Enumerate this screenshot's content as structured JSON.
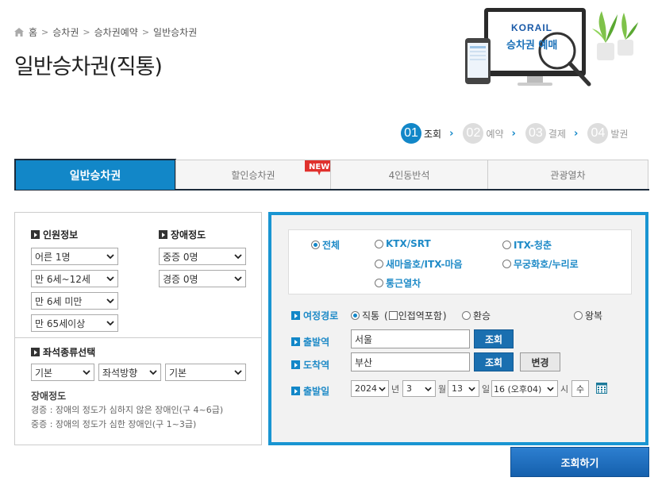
{
  "breadcrumb": [
    "홈",
    "승차권",
    "승차권예약",
    "일반승차권"
  ],
  "page_title": "일반승차권(직통)",
  "hero": {
    "brand": "KORAIL",
    "caption": "승차권 예매"
  },
  "steps": [
    {
      "num": "01",
      "label": "조회",
      "active": true
    },
    {
      "num": "02",
      "label": "예약",
      "active": false
    },
    {
      "num": "03",
      "label": "결제",
      "active": false
    },
    {
      "num": "04",
      "label": "발권",
      "active": false
    }
  ],
  "tabs": [
    {
      "label": "일반승차권",
      "active": true
    },
    {
      "label": "할인승차권",
      "badge": "NEW"
    },
    {
      "label": "4인동반석"
    },
    {
      "label": "관광열차"
    }
  ],
  "passengers": {
    "title": "인원정보",
    "adult": "어른 1명",
    "child": "만 6세~12세",
    "infant": "만 6세 미만",
    "senior": "만 65세이상"
  },
  "disability": {
    "title": "장애정도",
    "severe": "중증 0명",
    "mild": "경증 0명"
  },
  "seat": {
    "title": "좌석종류선택",
    "type": "기본",
    "direction": "좌석방향",
    "option": "기본"
  },
  "disability_note": {
    "head": "장애정도",
    "mild": "경증 : 장애의 정도가 심하지 않은 장애인(구 4~6급)",
    "severe": "중증 : 장애의 정도가 심한 장애인(구 1~3급)"
  },
  "train_types": {
    "all": "전체",
    "ktx": "KTX/SRT",
    "itx_cheongchun": "ITX-청춘",
    "saemaeul": "새마을호/ITX-마음",
    "mugunghwa": "무궁화호/누리로",
    "commuter": "통근열차"
  },
  "route": {
    "label": "여정경로",
    "direct": "직통",
    "paren_open": "(",
    "nearby": "인접역포함",
    "paren_close": ")",
    "transfer": "환승",
    "round_trip": "왕복"
  },
  "departure": {
    "label": "출발역",
    "value": "서울",
    "search": "조회"
  },
  "arrival": {
    "label": "도착역",
    "value": "부산",
    "search": "조회",
    "swap": "변경"
  },
  "date": {
    "label": "출발일",
    "year": "2024",
    "year_unit": "년",
    "month": "3",
    "month_unit": "월",
    "day": "13",
    "day_unit": "일",
    "hour": "16 (오후04)",
    "hour_unit": "시",
    "weekday": "수"
  },
  "submit": "조회하기",
  "colors": {
    "accent": "#1287c8",
    "panel_border": "#1995d2",
    "new_badge": "#e0312d"
  }
}
